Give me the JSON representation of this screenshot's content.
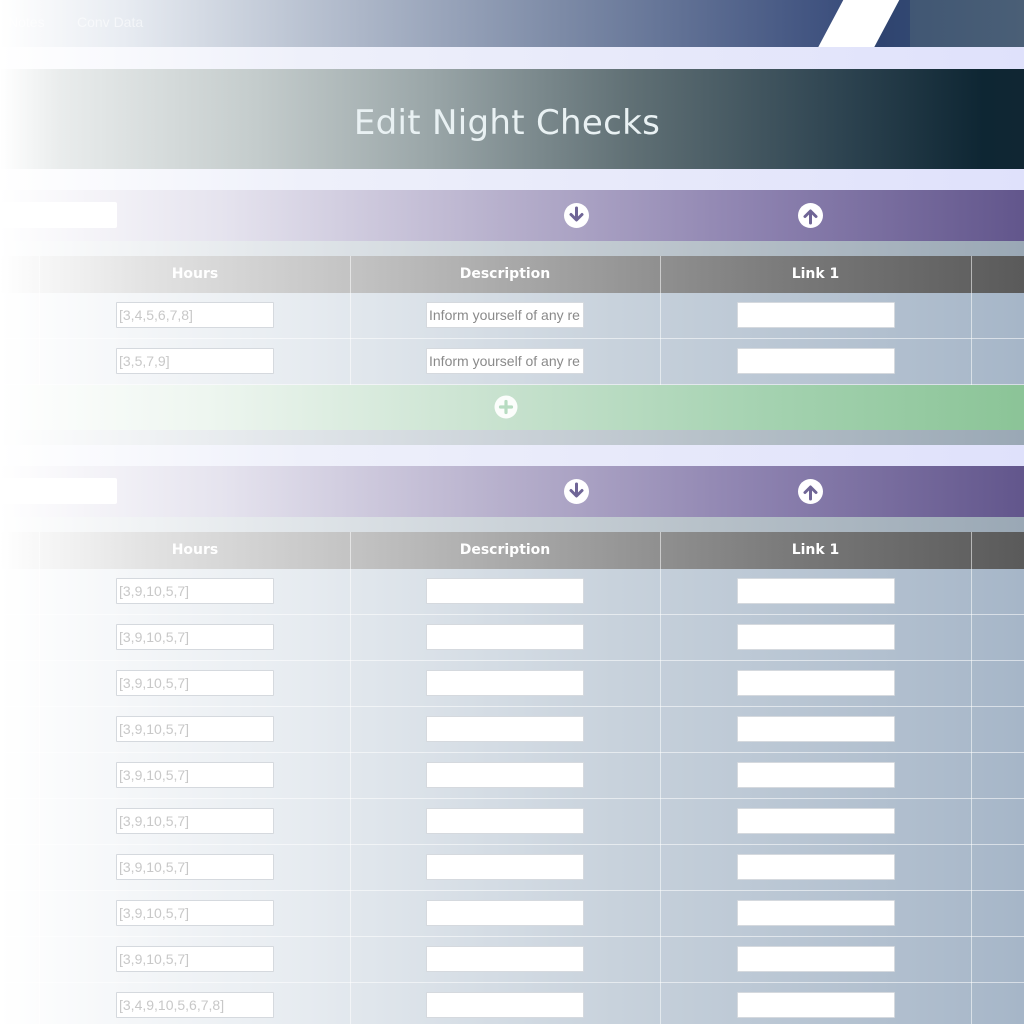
{
  "nav": {
    "items": [
      {
        "label": "Notes"
      },
      {
        "label": "Conv Data"
      }
    ]
  },
  "page": {
    "title": "Edit Night Checks"
  },
  "columns": {
    "hours": "Hours",
    "description": "Description",
    "link1": "Link 1"
  },
  "section1": {
    "rows": [
      {
        "hours": "[3,4,5,6,7,8]",
        "description": "Inform yourself of any re",
        "link1": ""
      },
      {
        "hours": "[3,5,7,9]",
        "description": "Inform yourself of any re",
        "link1": ""
      }
    ]
  },
  "section2": {
    "rows": [
      {
        "hours": "[3,9,10,5,7]",
        "description": "",
        "link1": ""
      },
      {
        "hours": "[3,9,10,5,7]",
        "description": "",
        "link1": ""
      },
      {
        "hours": "[3,9,10,5,7]",
        "description": "",
        "link1": ""
      },
      {
        "hours": "[3,9,10,5,7]",
        "description": "",
        "link1": ""
      },
      {
        "hours": "[3,9,10,5,7]",
        "description": "",
        "link1": ""
      },
      {
        "hours": "[3,9,10,5,7]",
        "description": "",
        "link1": ""
      },
      {
        "hours": "[3,9,10,5,7]",
        "description": "",
        "link1": ""
      },
      {
        "hours": "[3,9,10,5,7]",
        "description": "",
        "link1": ""
      },
      {
        "hours": "[3,9,10,5,7]",
        "description": "",
        "link1": ""
      },
      {
        "hours": "[3,4,9,10,5,6,7,8]",
        "description": "",
        "link1": ""
      }
    ]
  },
  "icons": {
    "move_down": "arrow-down-circle-icon",
    "move_up": "arrow-up-circle-icon",
    "add": "plus-circle-icon"
  },
  "colors": {
    "control_bar_accent": "#62568c",
    "add_bar_accent": "#8bc497",
    "title_bar_dark": "#0e2633"
  }
}
